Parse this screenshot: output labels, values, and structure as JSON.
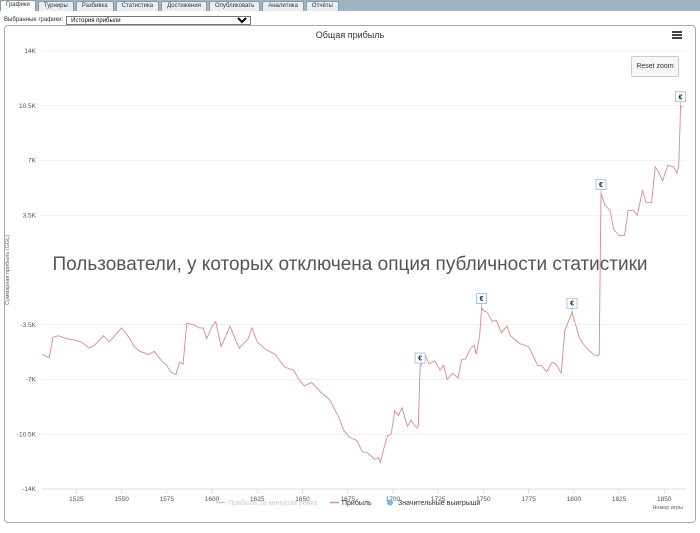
{
  "tabs": [
    {
      "label": "Графики",
      "active": true
    },
    {
      "label": "Турниры",
      "active": false
    },
    {
      "label": "Разбивка",
      "active": false
    },
    {
      "label": "Статистика",
      "active": false
    },
    {
      "label": "Достижения",
      "active": false
    },
    {
      "label": "Опубликовать",
      "active": false
    },
    {
      "label": "Аналитика",
      "active": false
    },
    {
      "label": "Отчёты",
      "active": false
    }
  ],
  "selector": {
    "label": "Выбранные графики:",
    "value": "История прибыли"
  },
  "reset_zoom_label": "Reset zoom",
  "overlay_message": "Пользователи, у которых отключена опция публичности статистики",
  "chart_data": {
    "type": "line",
    "title": "Общая прибыль",
    "xlabel": "Номер игры",
    "ylabel": "Суммарная прибыль (GGL)",
    "ylim": [
      -14000,
      14000
    ],
    "y_ticks": [
      -14000,
      -10500,
      -7000,
      -3500,
      3500,
      7000,
      10500,
      14000
    ],
    "y_tick_labels": [
      "-14K",
      "-10.5K",
      "-7K",
      "-3.5K",
      "3.5K",
      "7K",
      "10.5K",
      "14K"
    ],
    "x_ticks": [
      1525,
      1550,
      1575,
      1600,
      1625,
      1650,
      1675,
      1700,
      1725,
      1750,
      1775,
      1800,
      1825,
      1850
    ],
    "xlim": [
      1506,
      1862
    ],
    "legend": [
      {
        "name": "Прибыль за минусом рейка",
        "color": "#cccccc",
        "enabled": false
      },
      {
        "name": "Прибыль",
        "color": "#d98b8b",
        "enabled": true
      },
      {
        "name": "Значительные выигрыши",
        "color": "#7cb5ec",
        "enabled": true
      }
    ],
    "series": [
      {
        "name": "Прибыль",
        "color": "#d98b8b",
        "x": [
          1506,
          1510,
          1512,
          1515,
          1520,
          1525,
          1528,
          1532,
          1535,
          1540,
          1543,
          1547,
          1550,
          1554,
          1557,
          1560,
          1565,
          1568,
          1572,
          1575,
          1577,
          1580,
          1582,
          1584,
          1586,
          1590,
          1593,
          1595,
          1597,
          1600,
          1602,
          1605,
          1610,
          1612,
          1615,
          1620,
          1622,
          1625,
          1630,
          1635,
          1640,
          1645,
          1648,
          1651,
          1655,
          1660,
          1665,
          1670,
          1673,
          1676,
          1680,
          1683,
          1686,
          1690,
          1692,
          1693,
          1695,
          1697,
          1699,
          1701,
          1703,
          1705,
          1708,
          1710,
          1713,
          1714,
          1715,
          1718,
          1720,
          1723,
          1726,
          1728,
          1730,
          1733,
          1736,
          1738,
          1740,
          1743,
          1745,
          1746,
          1747,
          1748,
          1749,
          1750,
          1752,
          1755,
          1757,
          1760,
          1763,
          1765,
          1770,
          1775,
          1780,
          1782,
          1785,
          1788,
          1790,
          1793,
          1795,
          1798,
          1799,
          1800,
          1803,
          1805,
          1808,
          1811,
          1813,
          1814,
          1815,
          1817,
          1820,
          1822,
          1825,
          1828,
          1830,
          1833,
          1835,
          1838,
          1840,
          1843,
          1845,
          1847,
          1849,
          1852,
          1855,
          1857,
          1858,
          1859,
          1860
        ],
        "y": [
          -5400,
          -5600,
          -4300,
          -4200,
          -4400,
          -4500,
          -4600,
          -5000,
          -4800,
          -4200,
          -4600,
          -4100,
          -3700,
          -4300,
          -4900,
          -5200,
          -5400,
          -5200,
          -5800,
          -6100,
          -6500,
          -6700,
          -5900,
          -6000,
          -3400,
          -3500,
          -3700,
          -3700,
          -4400,
          -3600,
          -3300,
          -4900,
          -3600,
          -4200,
          -5000,
          -4400,
          -3700,
          -4600,
          -5100,
          -5400,
          -6200,
          -6400,
          -7000,
          -7400,
          -7200,
          -7800,
          -8300,
          -9400,
          -10300,
          -10700,
          -10900,
          -11600,
          -11700,
          -12100,
          -12000,
          -12300,
          -11400,
          -10600,
          -10500,
          -9000,
          -9300,
          -8800,
          -10000,
          -9600,
          -10100,
          -10000,
          -6200,
          -5500,
          -6000,
          -5800,
          -6400,
          -6100,
          -7000,
          -6600,
          -6900,
          -5700,
          -5700,
          -5000,
          -4800,
          -5400,
          -4800,
          -4100,
          -2400,
          -2600,
          -2700,
          -3300,
          -3200,
          -4000,
          -3600,
          -4200,
          -4700,
          -4900,
          -6100,
          -6100,
          -6500,
          -5900,
          -6000,
          -6600,
          -3900,
          -3000,
          -2700,
          -3100,
          -4300,
          -4700,
          -5100,
          -5400,
          -5500,
          -5400,
          4900,
          4200,
          3800,
          2600,
          2200,
          2200,
          3800,
          3800,
          3500,
          5100,
          4300,
          4300,
          6600,
          6200,
          5700,
          6700,
          6600,
          6200,
          6700,
          10500,
          10400
        ]
      }
    ],
    "big_wins": [
      {
        "x": 1715,
        "y": -6200,
        "label": "€"
      },
      {
        "x": 1749,
        "y": -2400,
        "label": "€"
      },
      {
        "x": 1799,
        "y": -2700,
        "label": "€"
      },
      {
        "x": 1815,
        "y": 4900,
        "label": "€"
      },
      {
        "x": 1859,
        "y": 10500,
        "label": "€"
      }
    ]
  }
}
